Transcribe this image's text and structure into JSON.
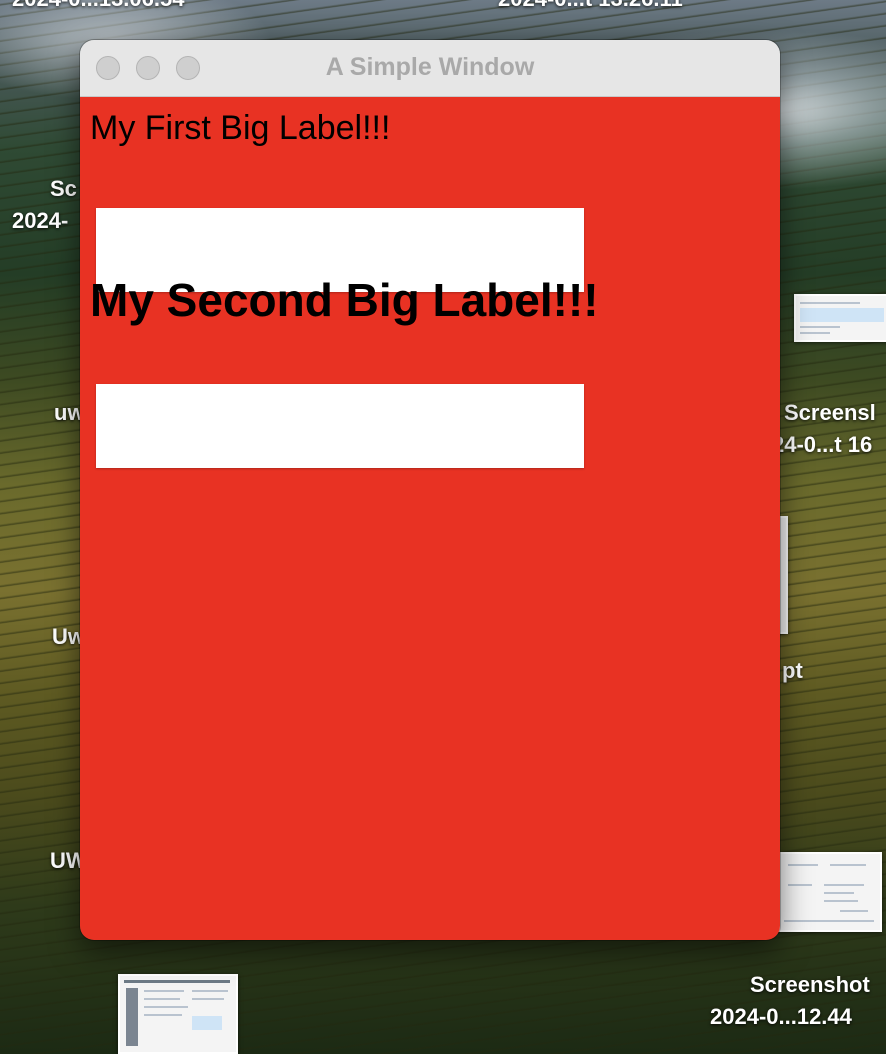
{
  "desktop": {
    "labels": {
      "top_left": "2024-0...13.06.54",
      "top_right": "2024-0...t 13.26.11",
      "sc_left_1": "Sc",
      "sc_left_2": "2024-",
      "uw_1": "uw",
      "uw_2": "Uw",
      "uw_3": "UW",
      "right_screens": "Screensl",
      "right_date": "24-0...t 16",
      "right_pt": "pt",
      "bottom_right_1": "Screenshot",
      "bottom_right_2": "2024-0...12.44"
    }
  },
  "window": {
    "title": "A Simple Window",
    "background_color": "#e83223",
    "traffic_lights": [
      "close",
      "minimize",
      "zoom"
    ],
    "label_1": "My First Big Label!!!",
    "field_1": {
      "value": "",
      "placeholder": ""
    },
    "label_2": "My Second Big Label!!!",
    "field_2": {
      "value": "",
      "placeholder": ""
    }
  }
}
